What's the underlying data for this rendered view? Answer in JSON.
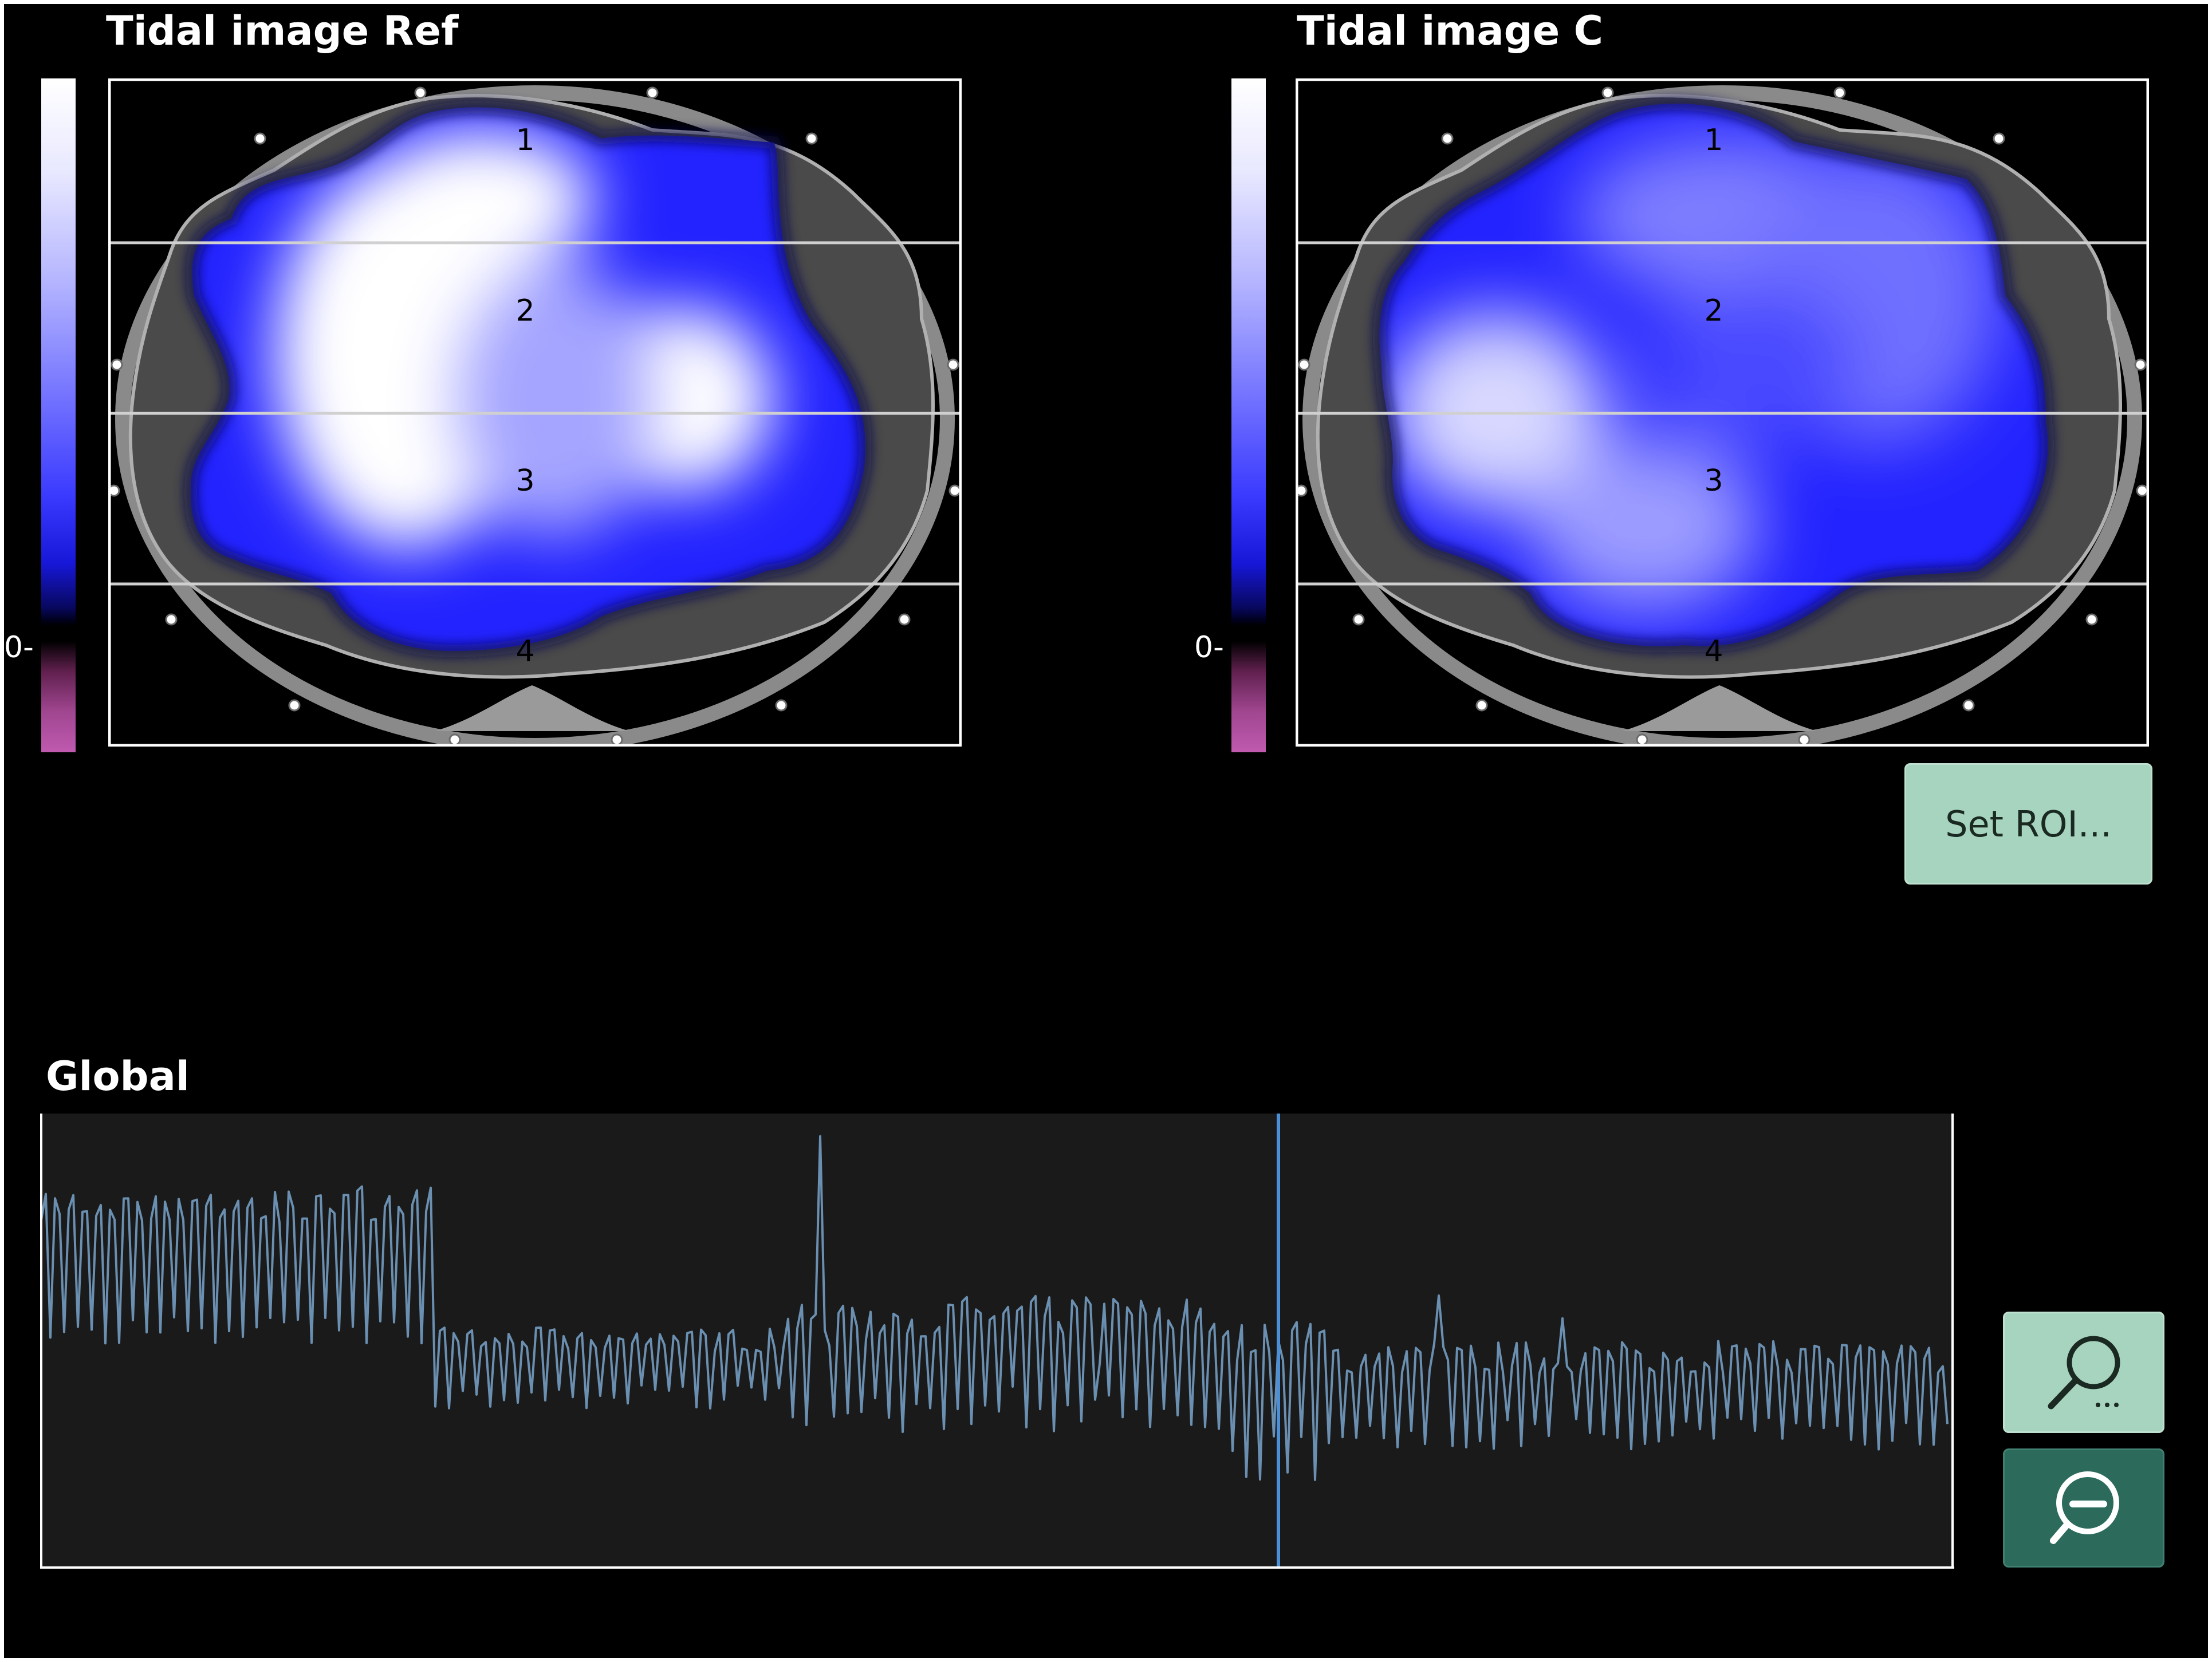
{
  "panels": {
    "ref": {
      "title": "Tidal image Ref",
      "zero_label": "0-",
      "regions": [
        "1",
        "2",
        "3",
        "4"
      ]
    },
    "c": {
      "title": "Tidal image C",
      "zero_label": "0-",
      "regions": [
        "1",
        "2",
        "3",
        "4"
      ]
    }
  },
  "buttons": {
    "set_roi_label": "Set ROI...",
    "zoom_in_icon": "magnifier-ellipsis-icon",
    "zoom_out_icon": "zoom-out-minus-icon"
  },
  "global": {
    "title": "Global",
    "line_color": "#6a8fb0",
    "cursor_color": "#4a8fd8"
  },
  "colors": {
    "background": "#000000",
    "plot_background": "#1a1a1a",
    "lung_blue": "#2323ff",
    "button_light": "#a7d4bf",
    "button_dark": "#2c6a5c"
  }
}
